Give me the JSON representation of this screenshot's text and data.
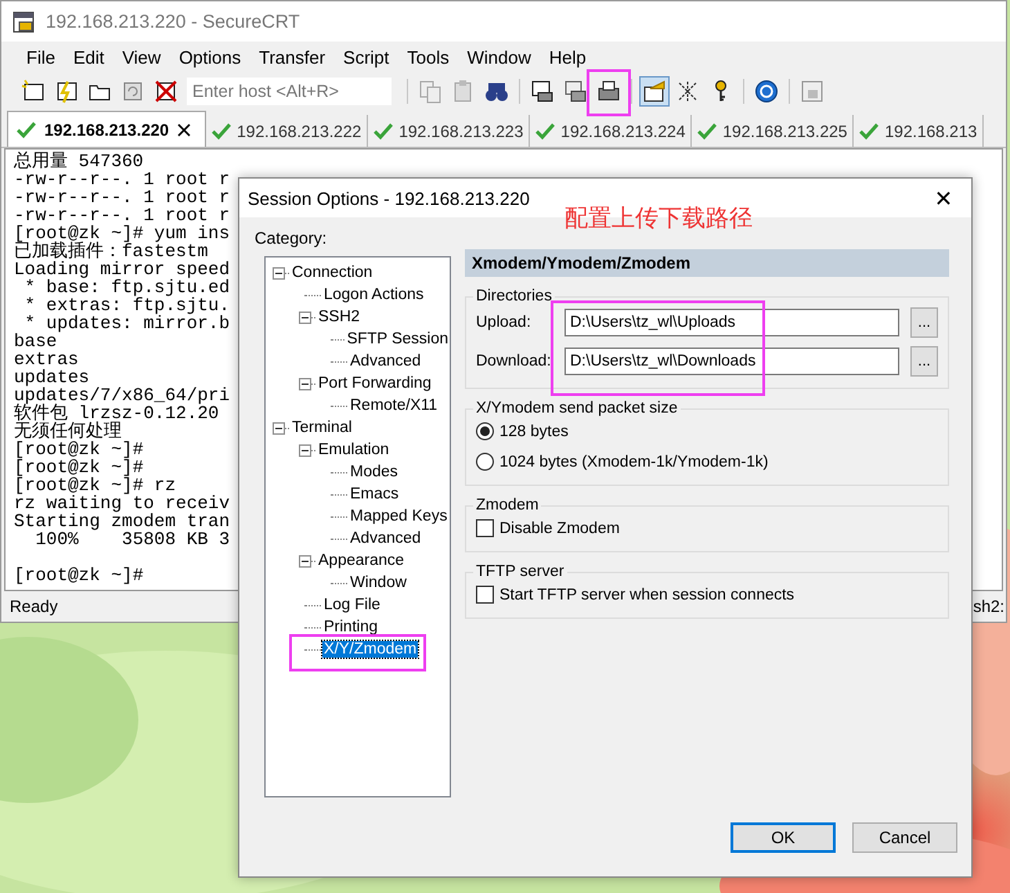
{
  "window": {
    "title": "192.168.213.220 - SecureCRT"
  },
  "menu": [
    "File",
    "Edit",
    "View",
    "Options",
    "Transfer",
    "Script",
    "Tools",
    "Window",
    "Help"
  ],
  "host_field": {
    "placeholder": "Enter host <Alt+R>"
  },
  "tabs": [
    {
      "label": "192.168.213.220",
      "selected": true
    },
    {
      "label": "192.168.213.222",
      "selected": false
    },
    {
      "label": "192.168.213.223",
      "selected": false
    },
    {
      "label": "192.168.213.224",
      "selected": false
    },
    {
      "label": "192.168.213.225",
      "selected": false
    },
    {
      "label": "192.168.213",
      "selected": false
    }
  ],
  "terminal": {
    "blocks": [
      {
        "lines": [
          {
            "text": "总用量 547360"
          },
          {
            "text": "-rw-r--r--. 1 root r"
          },
          {
            "text": "-rw-r--r--. 1 root r"
          },
          {
            "text": "-rw-r--r--. 1 root r"
          },
          {
            "text": "[root@zk ~]# yum ins"
          },
          {
            "text": "已加载插件：fastestm"
          },
          {
            "text": "Loading mirror speed"
          },
          {
            "text": " * base: ftp.sjtu.ed"
          },
          {
            "text": " * extras: ftp.sjtu."
          },
          {
            "text": " * updates: mirror.b"
          },
          {
            "text": "base"
          },
          {
            "text": "extras"
          },
          {
            "text": "updates"
          },
          {
            "text": "updates/7/x86_64/pri"
          },
          {
            "text": "软件包 lrzsz-0.12.20"
          },
          {
            "text": "无须任何处理"
          },
          {
            "text": "[root@zk ~]#"
          },
          {
            "text": "[root@zk ~]#"
          },
          {
            "text": "[root@zk ~]# rz"
          },
          {
            "text": "rz waiting to receiv"
          },
          {
            "text": "Starting zmodem tran"
          },
          {
            "text": "  100%    35808 KB 3"
          }
        ]
      },
      {
        "lines": [
          {
            "text": "[root@zk ~]#"
          }
        ]
      }
    ]
  },
  "status_bar": {
    "left": "Ready",
    "right": "sh2:"
  },
  "dialog": {
    "title": "Session Options - 192.168.213.220",
    "close": "✕",
    "category_label": "Category:",
    "tree": [
      {
        "label": "Connection",
        "expanded": true,
        "selected": false,
        "children": [
          {
            "label": "Logon Actions",
            "selected": false
          },
          {
            "label": "SSH2",
            "expanded": true,
            "selected": false,
            "children": [
              {
                "label": "SFTP Session",
                "selected": false
              },
              {
                "label": "Advanced",
                "selected": false
              }
            ]
          },
          {
            "label": "Port Forwarding",
            "expanded": true,
            "selected": false,
            "children": [
              {
                "label": "Remote/X11",
                "selected": false
              }
            ]
          }
        ]
      },
      {
        "label": "Terminal",
        "expanded": true,
        "selected": false,
        "children": [
          {
            "label": "Emulation",
            "expanded": true,
            "selected": false,
            "children": [
              {
                "label": "Modes",
                "selected": false
              },
              {
                "label": "Emacs",
                "selected": false
              },
              {
                "label": "Mapped Keys",
                "selected": false
              },
              {
                "label": "Advanced",
                "selected": false
              }
            ]
          },
          {
            "label": "Appearance",
            "expanded": true,
            "selected": false,
            "children": [
              {
                "label": "Window",
                "selected": false
              }
            ]
          },
          {
            "label": "Log File",
            "selected": false
          },
          {
            "label": "Printing",
            "selected": false
          },
          {
            "label": "X/Y/Zmodem",
            "selected": true
          }
        ]
      }
    ],
    "panel_title": "Xmodem/Ymodem/Zmodem",
    "directories": {
      "legend": "Directories",
      "fields": [
        {
          "label": "Upload:",
          "value": "D:\\Users\\tz_wl\\Uploads",
          "browse": "..."
        },
        {
          "label": "Download:",
          "value": "D:\\Users\\tz_wl\\Downloads",
          "browse": "..."
        }
      ]
    },
    "packet_size": {
      "legend": "X/Ymodem send packet size",
      "options": [
        {
          "label": "128 bytes",
          "selected": true
        },
        {
          "label": "1024 bytes  (Xmodem-1k/Ymodem-1k)",
          "selected": false
        }
      ]
    },
    "zmodem": {
      "legend": "Zmodem",
      "option": {
        "label": "Disable Zmodem",
        "checked": false
      }
    },
    "tftp": {
      "legend": "TFTP server",
      "option": {
        "label": "Start TFTP server when session connects",
        "checked": false
      }
    },
    "buttons": [
      "OK",
      "Cancel"
    ]
  },
  "annotation": {
    "note": "配置上传下载路径"
  }
}
